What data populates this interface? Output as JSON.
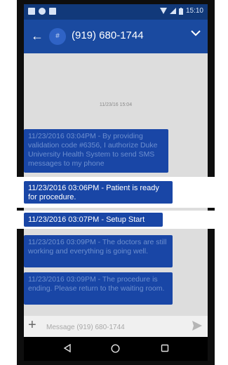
{
  "status_bar": {
    "time": "15:10"
  },
  "header": {
    "avatar_initial": "#",
    "contact": "(919) 680-1744"
  },
  "conversation": {
    "timestamp": "11/23/16 15:04",
    "messages": [
      {
        "text": "11/23/2016 03:04PM - By providing validation code #6356, I authorize Duke University Health System to send SMS messages to my phone"
      },
      {
        "text": "11/23/2016 03:06PM - Patient is ready for procedure."
      },
      {
        "text": "11/23/2016 03:07PM - Setup Start"
      },
      {
        "text": "11/23/2016 03:09PM - The doctors are still working and everything is going well."
      },
      {
        "text": "11/23/2016 03:09PM - The procedure is ending. Please return to the waiting room."
      }
    ]
  },
  "composer": {
    "placeholder": "Message (919) 680-1744"
  },
  "colors": {
    "app_bar": "#1a4aa0",
    "bubble": "#1946a6",
    "background": "#dddddd"
  }
}
